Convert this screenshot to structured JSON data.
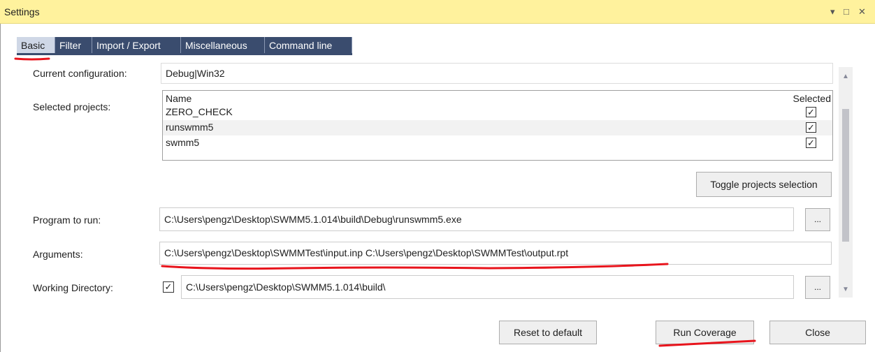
{
  "window": {
    "title": "Settings",
    "controls": {
      "dropdown": "▾",
      "maximize": "□",
      "close": "✕"
    }
  },
  "tabs": [
    {
      "label": "Basic",
      "active": true
    },
    {
      "label": "Filter",
      "active": false
    },
    {
      "label": "Import / Export",
      "active": false
    },
    {
      "label": "Miscellaneous",
      "active": false
    },
    {
      "label": "Command line",
      "active": false
    }
  ],
  "basic": {
    "current_configuration": {
      "label": "Current configuration:",
      "value": "Debug|Win32"
    },
    "selected_projects": {
      "label": "Selected projects:",
      "columns": {
        "name": "Name",
        "selected": "Selected"
      },
      "rows": [
        {
          "name": "ZERO_CHECK",
          "selected": true
        },
        {
          "name": "runswmm5",
          "selected": true
        },
        {
          "name": "swmm5",
          "selected": true
        }
      ],
      "toggle_button": "Toggle projects selection"
    },
    "program_to_run": {
      "label": "Program to run:",
      "value": "C:\\Users\\pengz\\Desktop\\SWMM5.1.014\\build\\Debug\\runswmm5.exe",
      "browse": "..."
    },
    "arguments": {
      "label": "Arguments:",
      "value": "C:\\Users\\pengz\\Desktop\\SWMMTest\\input.inp C:\\Users\\pengz\\Desktop\\SWMMTest\\output.rpt"
    },
    "working_directory": {
      "label": "Working Directory:",
      "checked": true,
      "value": "C:\\Users\\pengz\\Desktop\\SWMM5.1.014\\build\\",
      "browse": "..."
    }
  },
  "footer": {
    "reset_button": "Reset to default",
    "run_button": "Run Coverage",
    "close_button": "Close"
  },
  "colors": {
    "titlebar": "#fff29d",
    "tab_inactive": "#3a4c6e",
    "tab_active": "#cfd7e6",
    "annotation": "#e8141c"
  }
}
